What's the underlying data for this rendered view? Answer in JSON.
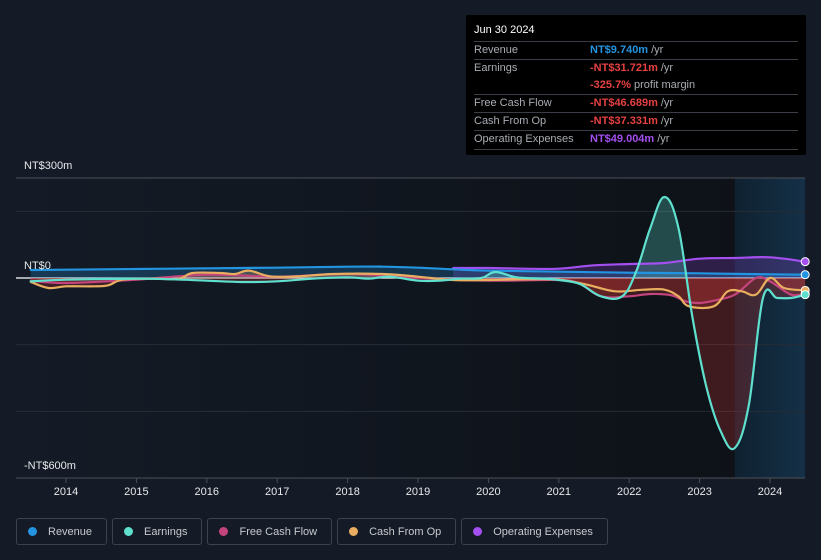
{
  "tooltip": {
    "date": "Jun 30 2024",
    "rows": [
      {
        "label": "Revenue",
        "value": "NT$9.740m",
        "unit": "/yr",
        "color": "#2394df"
      },
      {
        "label": "Earnings",
        "value": "-NT$31.721m",
        "unit": "/yr",
        "color": "#e64141"
      },
      {
        "label": "",
        "value": "-325.7%",
        "unit": "profit margin",
        "color": "#e64141"
      },
      {
        "label": "Free Cash Flow",
        "value": "-NT$46.689m",
        "unit": "/yr",
        "color": "#e64141"
      },
      {
        "label": "Cash From Op",
        "value": "-NT$37.331m",
        "unit": "/yr",
        "color": "#e64141"
      },
      {
        "label": "Operating Expenses",
        "value": "NT$49.004m",
        "unit": "/yr",
        "color": "#a44ff0"
      }
    ]
  },
  "legend": [
    {
      "label": "Revenue",
      "color": "#2394df"
    },
    {
      "label": "Earnings",
      "color": "#5fe0ce"
    },
    {
      "label": "Free Cash Flow",
      "color": "#c4457e"
    },
    {
      "label": "Cash From Op",
      "color": "#e9ae5f"
    },
    {
      "label": "Operating Expenses",
      "color": "#a44ff0"
    }
  ],
  "chart_data": {
    "type": "line",
    "title": "",
    "xlabel": "",
    "ylabel": "",
    "ylim": [
      -600,
      300
    ],
    "xlim": [
      2013.3,
      2024.6
    ],
    "y_tick_labels": [
      {
        "value": 300,
        "label": "NT$300m"
      },
      {
        "value": 0,
        "label": "NT$0"
      },
      {
        "value": -600,
        "label": "-NT$600m"
      }
    ],
    "gridlines": [
      300,
      200,
      0,
      -200,
      -400,
      -600
    ],
    "x_ticks": [
      2014,
      2015,
      2016,
      2017,
      2018,
      2019,
      2020,
      2021,
      2022,
      2023,
      2024
    ],
    "highlight_range": [
      2023.5,
      2024.5
    ],
    "grid": true,
    "legend_position": "bottom",
    "series": [
      {
        "name": "Revenue",
        "color": "#2394df",
        "x": [
          2013.5,
          2014,
          2015,
          2016,
          2017,
          2018,
          2018.5,
          2019,
          2019.5,
          2020,
          2021,
          2022,
          2023,
          2024,
          2024.5
        ],
        "y": [
          24,
          25,
          27,
          29,
          31,
          34,
          34,
          31,
          26,
          22,
          19,
          16,
          14,
          11,
          10
        ]
      },
      {
        "name": "Earnings",
        "color": "#5fe0ce",
        "x": [
          2013.5,
          2014,
          2015,
          2015.5,
          2016,
          2016.5,
          2017,
          2017.5,
          2018,
          2018.3,
          2018.6,
          2019,
          2019.3,
          2019.6,
          2019.9,
          2020.1,
          2020.4,
          2020.8,
          2021,
          2021.3,
          2021.6,
          2021.9,
          2022.1,
          2022.3,
          2022.5,
          2022.7,
          2022.9,
          2023.1,
          2023.3,
          2023.5,
          2023.7,
          2023.9,
          2024.1,
          2024.3,
          2024.5
        ],
        "y": [
          -10,
          -5,
          -2,
          -4,
          -8,
          -12,
          -10,
          -2,
          2,
          -2,
          4,
          -8,
          -8,
          -2,
          0,
          18,
          2,
          -2,
          -6,
          -18,
          -55,
          -55,
          20,
          150,
          243,
          150,
          -120,
          -330,
          -460,
          -510,
          -380,
          -60,
          -60,
          -60,
          -50
        ]
      },
      {
        "name": "Free Cash Flow",
        "color": "#c4457e",
        "x": [
          2013.5,
          2014,
          2015,
          2016,
          2017,
          2018,
          2019,
          2020,
          2021,
          2021.3,
          2021.6,
          2022,
          2022.3,
          2022.6,
          2022.8,
          2023,
          2023.2,
          2023.5,
          2023.8,
          2024,
          2024.3,
          2024.5
        ],
        "y": [
          -8,
          -15,
          -5,
          10,
          4,
          12,
          0,
          -8,
          -6,
          -18,
          -55,
          -55,
          -48,
          -52,
          -70,
          -75,
          -68,
          -50,
          0,
          -10,
          -50,
          -47
        ]
      },
      {
        "name": "Cash From Op",
        "color": "#e9ae5f",
        "x": [
          2013.5,
          2013.75,
          2014,
          2014.4,
          2014.6,
          2014.8,
          2015.2,
          2015.6,
          2015.8,
          2016.2,
          2016.4,
          2016.6,
          2016.9,
          2017.3,
          2017.8,
          2018.5,
          2019,
          2019.5,
          2020,
          2020.5,
          2021,
          2021.4,
          2021.8,
          2022.2,
          2022.5,
          2022.7,
          2022.85,
          2023.2,
          2023.4,
          2023.6,
          2023.8,
          2024,
          2024.2,
          2024.5
        ],
        "y": [
          -12,
          -30,
          -25,
          -25,
          -22,
          -5,
          -2,
          -2,
          15,
          15,
          12,
          22,
          5,
          5,
          12,
          12,
          4,
          -6,
          -6,
          -4,
          -5,
          -20,
          -40,
          -35,
          -35,
          -55,
          -85,
          -85,
          -40,
          -40,
          -50,
          0,
          -30,
          -37
        ]
      },
      {
        "name": "Operating Expenses",
        "color": "#a44ff0",
        "x": [
          2019.5,
          2020,
          2020.5,
          2021,
          2021.5,
          2022,
          2022.5,
          2023,
          2023.5,
          2024,
          2024.5
        ],
        "y": [
          30,
          30,
          28,
          28,
          38,
          42,
          45,
          58,
          60,
          62,
          49
        ]
      }
    ]
  }
}
